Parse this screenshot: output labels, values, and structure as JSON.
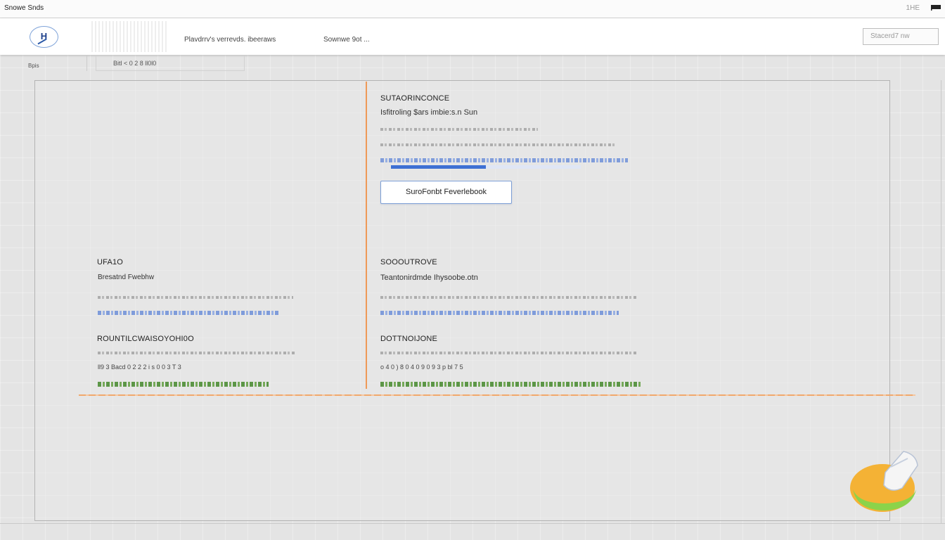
{
  "window": {
    "title": "Snowe Snds",
    "meta": "1HE"
  },
  "toolbar": {
    "logo_text": "H",
    "nav": [
      "Plavdrrv's verrevds. ibeeraws",
      "Sownwe 9ot ..."
    ],
    "search_placeholder": "Stacerd7 nw"
  },
  "subbar": {
    "label": "Bpis",
    "tab": "Bitl < 0 2 8 ll0l0"
  },
  "sections": {
    "top_right": {
      "heading": "SUTAORINCONCE",
      "subheading": "Isfitroling $ars imbie:s.n Sun",
      "button": "SuroFonbt Feverlebook",
      "progress": 0.5
    },
    "mid_left": {
      "heading": "UFA1O",
      "subheading": "Bresatnd Fwebhw"
    },
    "mid_right": {
      "heading": "SOOOUTROVE",
      "subheading": "Teantonirdmde Ihysoobe.otn"
    },
    "bottom_left": {
      "heading": "ROUNTILCWAISOYOHI0O",
      "line": "ll9 3 Bacd 0 2 2 2 i s 0 0 3 T 3"
    },
    "bottom_right": {
      "heading": "DOTTNOIJONE",
      "line": "o 4 0 ) 8 0 4 0 9 0 9 3 p bl 7 5"
    }
  },
  "colors": {
    "accent_orange": "#ef9a58",
    "accent_blue": "#3e70d4",
    "accent_green": "#4d8d35"
  }
}
